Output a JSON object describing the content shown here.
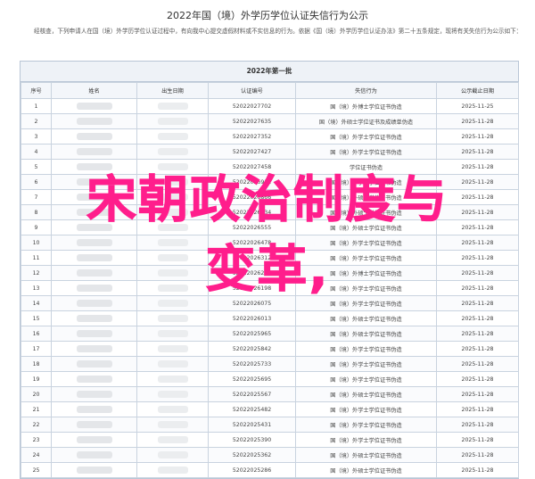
{
  "header": {
    "title": "2022年国（境）外学历学位认证失信行为公示",
    "notice": "经核查，下列申请人在国（境）外学历学位认证过程中，有向我中心提交虚假材料或不实信息的行为。依据《国（境）外学历学位认证办法》第二十五条规定，现将有关失信行为公示如下："
  },
  "table": {
    "caption": "2022年第一批",
    "headers": [
      "序号",
      "姓名",
      "出生日期",
      "认证编号",
      "失信行为",
      "公示截止日期"
    ],
    "rows": [
      {
        "no": "1",
        "code": "52022027702",
        "behavior": "国（境）外博士学位证书伪造",
        "date": "2025-11-25"
      },
      {
        "no": "2",
        "code": "52022027635",
        "behavior": "国（境）外硕士学位证书及成绩单伪造",
        "date": "2025-11-28"
      },
      {
        "no": "3",
        "code": "52022027352",
        "behavior": "国（境）外学士学位证书伪造",
        "date": "2025-11-28"
      },
      {
        "no": "4",
        "code": "52022027427",
        "behavior": "国（境）外学士学位证书伪造",
        "date": "2025-11-28"
      },
      {
        "no": "5",
        "code": "52022027458",
        "behavior": "学位证书伪造",
        "date": "2025-11-28"
      },
      {
        "no": "6",
        "code": "52022026912",
        "behavior": "国（境）外学士学位证书伪造",
        "date": "2025-11-28"
      },
      {
        "no": "7",
        "code": "52022026866",
        "behavior": "国（境）外硕士学位证书伪造",
        "date": "2025-11-28"
      },
      {
        "no": "8",
        "code": "52022026734",
        "behavior": "国（境）外硕士学位证书伪造",
        "date": "2025-11-28"
      },
      {
        "no": "9",
        "code": "52022026555",
        "behavior": "国（境）外硕士学位证书伪造",
        "date": "2025-11-28"
      },
      {
        "no": "10",
        "code": "52022026478",
        "behavior": "国（境）外学士学位证书伪造",
        "date": "2025-11-28"
      },
      {
        "no": "11",
        "code": "52022026312",
        "behavior": "国（境）外学士学位证书伪造",
        "date": "2025-11-28"
      },
      {
        "no": "12",
        "code": "52022026233",
        "behavior": "国（境）外博士学位证书伪造",
        "date": "2025-11-28"
      },
      {
        "no": "13",
        "code": "52022026198",
        "behavior": "国（境）外学士学位证书伪造",
        "date": "2025-11-28"
      },
      {
        "no": "14",
        "code": "52022026075",
        "behavior": "国（境）外学士学位证书伪造",
        "date": "2025-11-28"
      },
      {
        "no": "15",
        "code": "52022026013",
        "behavior": "国（境）外硕士学位证书伪造",
        "date": "2025-11-28"
      },
      {
        "no": "16",
        "code": "52022025965",
        "behavior": "国（境）外硕士学位证书伪造",
        "date": "2025-11-28"
      },
      {
        "no": "17",
        "code": "52022025842",
        "behavior": "国（境）外学士学位证书伪造",
        "date": "2025-11-28"
      },
      {
        "no": "18",
        "code": "52022025733",
        "behavior": "国（境）外学士学位证书伪造",
        "date": "2025-11-28"
      },
      {
        "no": "19",
        "code": "52022025695",
        "behavior": "国（境）外学士学位证书伪造",
        "date": "2025-11-28"
      },
      {
        "no": "20",
        "code": "52022025567",
        "behavior": "国（境）外硕士学位证书伪造",
        "date": "2025-11-28"
      },
      {
        "no": "21",
        "code": "52022025482",
        "behavior": "国（境）外学士学位证书伪造",
        "date": "2025-11-28"
      },
      {
        "no": "22",
        "code": "52022025431",
        "behavior": "国（境）外学士学位证书伪造",
        "date": "2025-11-28"
      },
      {
        "no": "23",
        "code": "52022025390",
        "behavior": "国（境）外学士学位证书伪造",
        "date": "2025-11-28"
      },
      {
        "no": "24",
        "code": "52022025362",
        "behavior": "国（境）外硕士学位证书伪造",
        "date": "2025-11-28"
      },
      {
        "no": "25",
        "code": "52022025286",
        "behavior": "国（境）外硕士学位证书伪造",
        "date": "2025-11-28"
      }
    ]
  },
  "overlay": {
    "line1": "宋朝政治制度与",
    "line2": "变革,",
    "color": "#ff1e8c"
  }
}
